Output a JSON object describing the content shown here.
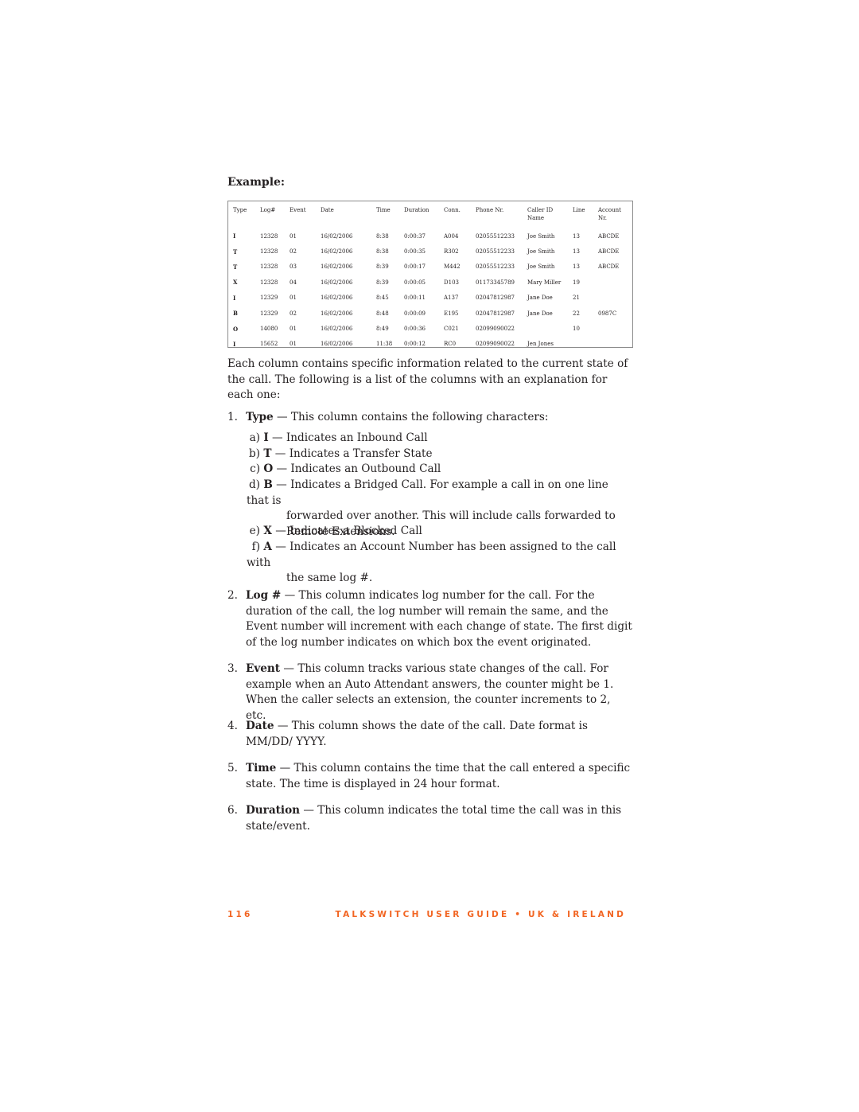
{
  "heading": "Example:",
  "table": {
    "headers": [
      "Type",
      "Log#",
      "Event",
      "Date",
      "Time",
      "Duration",
      "Conn.",
      "Phone Nr.",
      "Caller ID\nName",
      "Line",
      "Account\nNr."
    ],
    "rows": [
      [
        "I",
        "12328",
        "01",
        "16/02/2006",
        "8:38",
        "0:00:37",
        "A004",
        "02055512233",
        "Joe Smith",
        "13",
        "ABCDE"
      ],
      [
        "T",
        "12328",
        "02",
        "16/02/2006",
        "8:38",
        "0:00:35",
        "R302",
        "02055512233",
        "Joe Smith",
        "13",
        "ABCDE"
      ],
      [
        "T",
        "12328",
        "03",
        "16/02/2006",
        "8:39",
        "0:00:17",
        "M442",
        "02055512233",
        "Joe Smith",
        "13",
        "ABCDE"
      ],
      [
        "X",
        "12328",
        "04",
        "16/02/2006",
        "8:39",
        "0:00:05",
        "D103",
        "01173345789",
        "Mary Miller",
        "19",
        ""
      ],
      [
        "I",
        "12329",
        "01",
        "16/02/2006",
        "8:45",
        "0:00:11",
        "A137",
        "02047812987",
        "Jane Doe",
        "21",
        ""
      ],
      [
        "B",
        "12329",
        "02",
        "16/02/2006",
        "8:48",
        "0:00:09",
        "E195",
        "02047812987",
        "Jane Doe",
        "22",
        "0987C"
      ],
      [
        "O",
        "14080",
        "01",
        "16/02/2006",
        "8:49",
        "0:00:36",
        "C021",
        "02099090022",
        "",
        "10",
        ""
      ],
      [
        "I",
        "15652",
        "01",
        "16/02/2006",
        "11:38",
        "0:00:12",
        "RC0",
        "02099090022",
        "Jen Jones",
        "",
        ""
      ]
    ]
  },
  "intro": "Each column contains specific information related to the current state of the call. The following is a list of the columns with an explanation for each one:",
  "items": [
    {
      "num": "1.",
      "term": "Type",
      "text": " — This column contains the following characters:"
    },
    {
      "num": "2.",
      "term": "Log #",
      "text": " — This column indicates log number for the call. For the duration of the call, the log number will remain the same, and the Event number will increment with each change of state. The first digit of the log number indicates on which box the event originated."
    },
    {
      "num": "3.",
      "term": "Event",
      "text": " — This column tracks various state changes of the call. For example when an Auto Attendant answers, the counter might be 1. When the caller selects an extension, the counter increments to 2, etc."
    },
    {
      "num": "4.",
      "term": "Date",
      "text": " — This column shows the date of the call. Date format is MM/DD/ YYYY."
    },
    {
      "num": "5.",
      "term": "Time",
      "text": " — This column contains the time that the call entered a specific state. The time is displayed in 24 hour format."
    },
    {
      "num": "6.",
      "term": "Duration",
      "text": " — This column indicates the total time the call was in this state/event."
    }
  ],
  "subitems": [
    {
      "label": "a)",
      "term": "I",
      "text": " — Indicates an Inbound Call"
    },
    {
      "label": "b)",
      "term": "T",
      "text": " — Indicates a Transfer State"
    },
    {
      "label": "c)",
      "term": "O",
      "text": " — Indicates an Outbound Call"
    },
    {
      "label": "d)",
      "term": "B",
      "text": " — Indicates a Bridged Call. For example a call in on one line that is",
      "cont": "forwarded over another. This will include calls forwarded to Remote Extensions."
    },
    {
      "label": "e)",
      "term": "X",
      "text": " — Indicates a Blocked Call"
    },
    {
      "label": "f)",
      "term": "A",
      "text": " — Indicates an Account Number has been assigned to the call with",
      "cont": "the same log #."
    }
  ],
  "footer": {
    "page_number": "116",
    "title": "TALKSWITCH USER GUIDE • UK & IRELAND",
    "color": "#f26522"
  }
}
